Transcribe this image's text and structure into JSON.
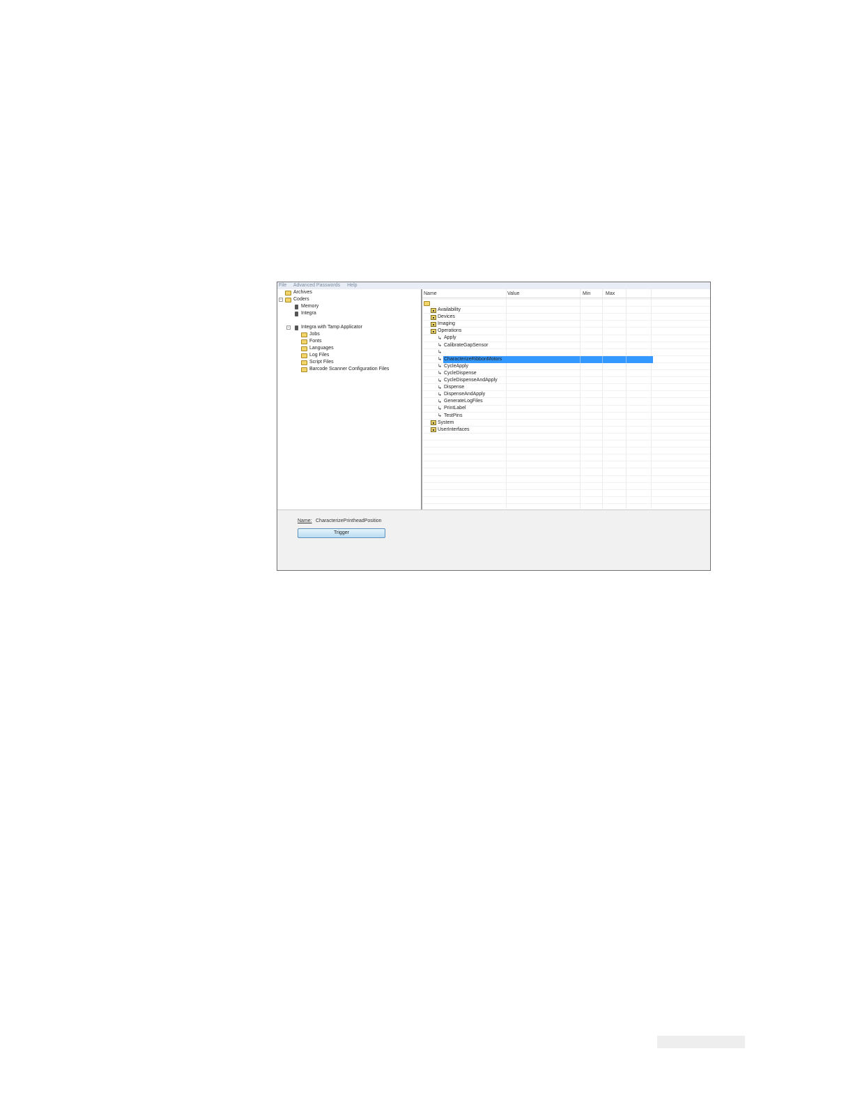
{
  "menu": [
    "File",
    "Advanced Passwords",
    "Help"
  ],
  "tree": {
    "archives": "Archives",
    "coders": "Coders",
    "memory": "Memory",
    "integra": "Integra",
    "integra_tamp": "Integra with Tamp Applicator",
    "children": [
      "Jobs",
      "Fonts",
      "Languages",
      "Log Files",
      "Script Files",
      "Barcode Scanner Configuration Files"
    ]
  },
  "grid": {
    "columns": [
      "Name",
      "Value",
      "Min",
      "Max"
    ],
    "groups_top": [
      "Availability",
      "Devices",
      "Imaging",
      "Operations"
    ],
    "operations": [
      "Apply",
      "CalibrateGapSensor",
      "CharacterizePrintheadPosition",
      "CharacterizeRibbonMotors",
      "CycleApply",
      "CycleDispense",
      "CycleDispenseAndApply",
      "Dispense",
      "DispenseAndApply",
      "GenerateLogFiles",
      "PrintLabel",
      "TestPins"
    ],
    "groups_bottom": [
      "System",
      "UserInterfaces"
    ],
    "selected_index": 2
  },
  "details": {
    "name_label": "Name:",
    "name_value": "CharacterizePrintheadPosition",
    "trigger_label": "Trigger"
  }
}
